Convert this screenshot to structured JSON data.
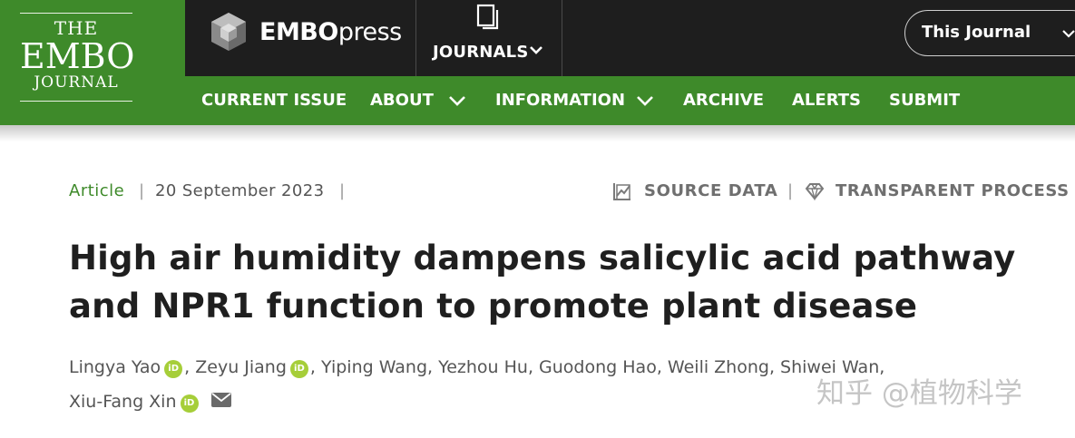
{
  "journal_logo": {
    "line1": "THE",
    "line2": "EMBO",
    "line3": "JOURNAL"
  },
  "publisher": {
    "name_bold": "EMBO",
    "name_light": "press"
  },
  "topbar": {
    "journals_label": "JOURNALS",
    "scope_select": "This Journal"
  },
  "nav": {
    "items": [
      {
        "label": "CURRENT ISSUE",
        "has_dropdown": false
      },
      {
        "label": "ABOUT",
        "has_dropdown": true
      },
      {
        "label": "INFORMATION",
        "has_dropdown": true
      },
      {
        "label": "ARCHIVE",
        "has_dropdown": false
      },
      {
        "label": "ALERTS",
        "has_dropdown": false
      },
      {
        "label": "SUBMIT",
        "has_dropdown": false
      }
    ]
  },
  "article": {
    "type": "Article",
    "separator": "|",
    "date": "20 September 2023",
    "tools": [
      {
        "label": "SOURCE DATA",
        "icon": "chart-icon"
      },
      {
        "label": "TRANSPARENT PROCESS",
        "icon": "diamond-icon"
      }
    ],
    "title": "High air humidity dampens salicylic acid pathway and NPR1 function to promote plant disease",
    "authors": [
      {
        "name": "Lingya Yao",
        "orcid": true
      },
      {
        "name": "Zeyu Jiang",
        "orcid": true
      },
      {
        "name": "Yiping Wang",
        "orcid": false
      },
      {
        "name": "Yezhou Hu",
        "orcid": false
      },
      {
        "name": "Guodong Hao",
        "orcid": false
      },
      {
        "name": "Weili Zhong",
        "orcid": false
      },
      {
        "name": "Shiwei Wan",
        "orcid": false
      },
      {
        "name": "Xiu-Fang Xin",
        "orcid": true,
        "corresponding": true
      }
    ],
    "orcid_badge": "iD"
  },
  "watermark": "知乎 @植物科学",
  "colors": {
    "brand_green": "#3e8a2a",
    "topbar": "#1e1e1e",
    "orcid_green": "#a6ce39"
  }
}
